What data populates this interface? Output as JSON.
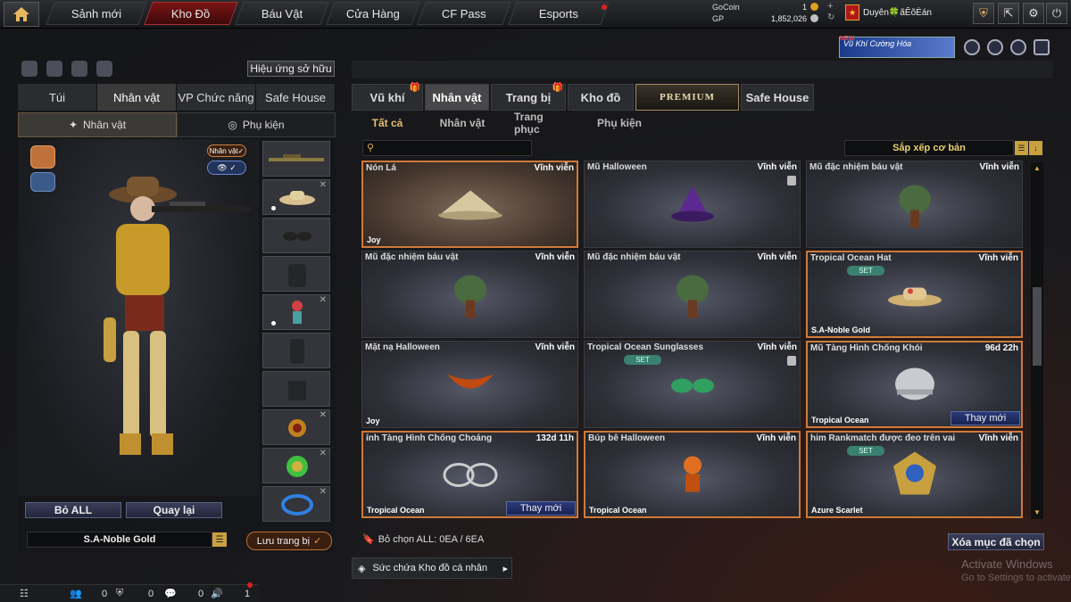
{
  "top_nav": {
    "tabs": [
      {
        "label": "Sảnh mới"
      },
      {
        "label": "Kho Đồ"
      },
      {
        "label": "Báu Vật"
      },
      {
        "label": "Cửa Hàng"
      },
      {
        "label": "CF Pass"
      },
      {
        "label": "Esports"
      }
    ],
    "active_tab": "Kho Đồ",
    "gocoin_label": "GoCoin",
    "gp_label": "GP",
    "gocoin_value": "1",
    "gp_value": "1,852,026",
    "player_name": "Duyên🍀ãÊõÈán"
  },
  "event_banner": {
    "new_label": "NEW",
    "text": "Vũ Khí Cường Hóa"
  },
  "left_panel": {
    "effect_button": "Hiệu ứng sở hữu",
    "tabs": [
      "Túi",
      "Nhân vật",
      "VP Chức năng",
      "Safe House"
    ],
    "active_tab": "Nhân vật",
    "sub_tabs": [
      "Nhân vật",
      "Phụ kiện"
    ],
    "char_tag": "Nhân vật",
    "remove_all": "Bỏ ALL",
    "back": "Quay lại",
    "set_name": "S.A-Noble Gold",
    "save_button": "Lưu trang bị"
  },
  "right_panel": {
    "tabs": [
      "Vũ khí",
      "Nhân vật",
      "Trang bị",
      "Kho đồ",
      "PREMIUM",
      "Safe House"
    ],
    "active_tab": "Nhân vật",
    "sub_tabs": [
      "Tất cả",
      "Nhân vật",
      "Trang phục",
      "Phụ kiện"
    ],
    "active_sub_tab": "Tất cả",
    "sort_label": "Sắp xếp cơ bản",
    "items": [
      {
        "name": "Nón Lá",
        "duration": "Vĩnh viễn",
        "sub": "Joy",
        "set": false,
        "change": false,
        "selected": true,
        "trash": false
      },
      {
        "name": "Mũ Halloween",
        "duration": "Vĩnh viễn",
        "sub": "",
        "set": false,
        "change": false,
        "selected": false,
        "trash": true
      },
      {
        "name": "Mũ đặc nhiệm báu vật",
        "duration": "Vĩnh viễn",
        "sub": "",
        "set": false,
        "change": false,
        "selected": false,
        "trash": false
      },
      {
        "name": "Mũ đặc nhiệm báu vật",
        "duration": "Vĩnh viễn",
        "sub": "",
        "set": false,
        "change": false,
        "selected": false,
        "trash": false
      },
      {
        "name": "Mũ đặc nhiệm báu vật",
        "duration": "Vĩnh viễn",
        "sub": "",
        "set": false,
        "change": false,
        "selected": false,
        "trash": false
      },
      {
        "name": "Tropical Ocean Hat",
        "duration": "Vĩnh viễn",
        "sub": "S.A-Noble Gold",
        "set": true,
        "change": false,
        "selected": true,
        "trash": false
      },
      {
        "name": "Mặt nạ Halloween",
        "duration": "Vĩnh viễn",
        "sub": "Joy",
        "set": false,
        "change": false,
        "selected": false,
        "trash": false
      },
      {
        "name": "Tropical Ocean Sunglasses",
        "duration": "Vĩnh viễn",
        "sub": "",
        "set": true,
        "change": false,
        "selected": false,
        "trash": true
      },
      {
        "name": "Mũ Tàng Hình Chống Khói",
        "duration": "96d 22h",
        "sub": "Tropical Ocean",
        "set": false,
        "change": true,
        "selected": true,
        "trash": false
      },
      {
        "name": "ính Tàng Hình Chống Choáng",
        "duration": "132d 11h",
        "sub": "Tropical Ocean",
        "set": false,
        "change": true,
        "selected": true,
        "trash": false
      },
      {
        "name": "Búp bê Halloween",
        "duration": "Vĩnh viễn",
        "sub": "Tropical Ocean",
        "set": false,
        "change": false,
        "selected": true,
        "trash": false
      },
      {
        "name": "him Rankmatch được đeo trên vai",
        "duration": "Vĩnh viễn",
        "sub": "Azure Scarlet",
        "set": true,
        "change": false,
        "selected": true,
        "trash": false
      }
    ],
    "set_tag": "SET",
    "change_label": "Thay mới",
    "select_all": "Bỏ chọn ALL: 0EA / 6EA",
    "delete_selected": "Xóa mục đã chọn",
    "capacity_label": "Sức chứa Kho đồ cá nhân"
  },
  "bottom_bar": {
    "count1": "0",
    "count2": "0",
    "count3": "0",
    "count4": "1"
  },
  "watermark": {
    "line1": "Activate Windows",
    "line2": "Go to Settings to activate"
  }
}
